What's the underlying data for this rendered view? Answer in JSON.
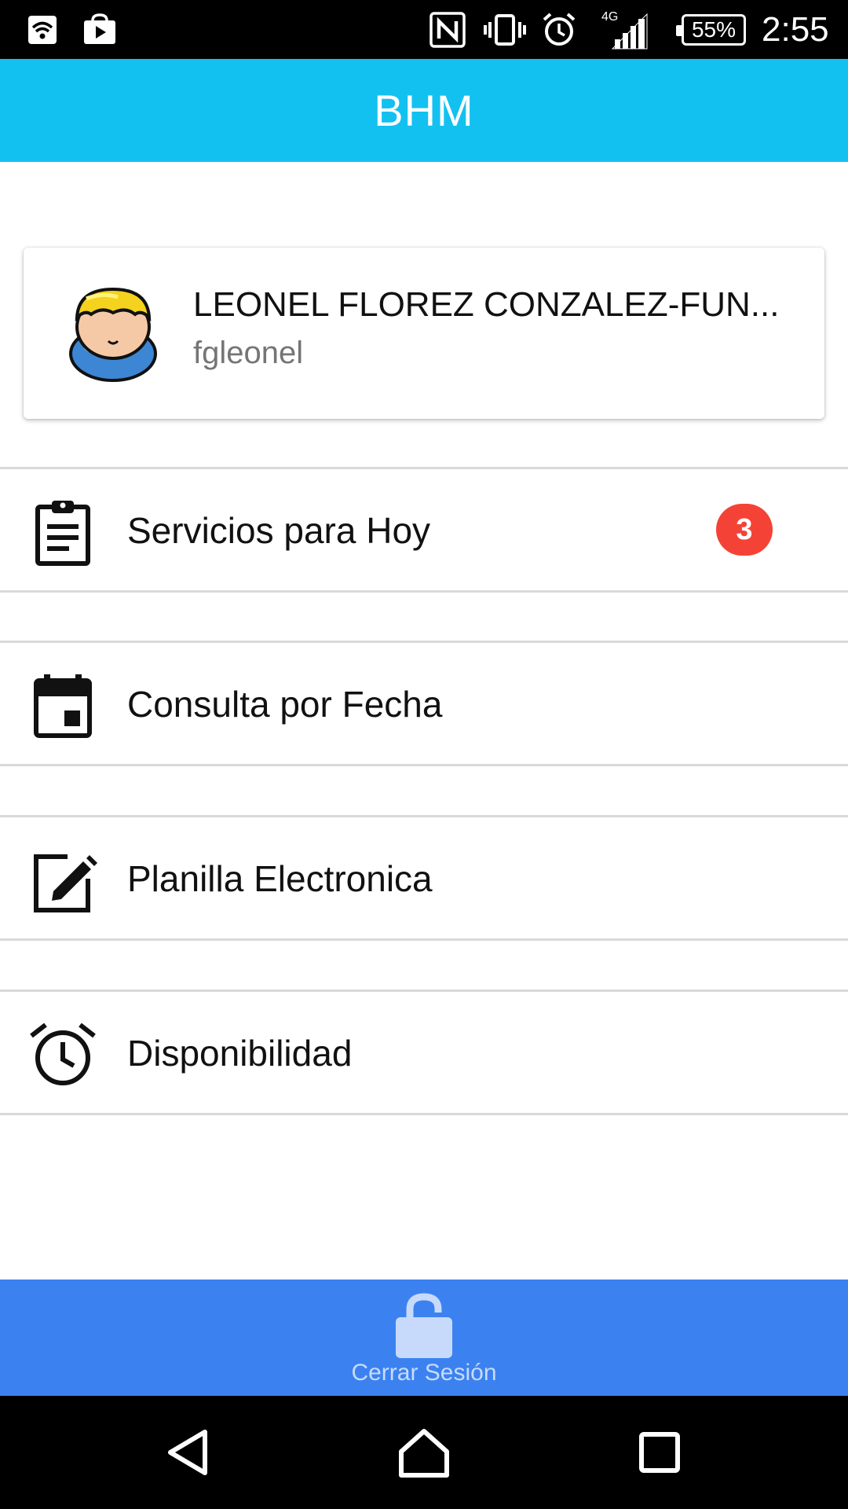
{
  "status_bar": {
    "battery": "55%",
    "network": "4G",
    "time": "2:55"
  },
  "app_bar": {
    "title": "BHM"
  },
  "profile": {
    "name": "LEONEL FLOREZ CONZALEZ-FUN...",
    "username": "fgleonel"
  },
  "menu": {
    "items": [
      {
        "label": "Servicios para Hoy",
        "icon": "clipboard-icon",
        "badge": "3"
      },
      {
        "label": "Consulta por Fecha",
        "icon": "calendar-icon"
      },
      {
        "label": "Planilla Electronica",
        "icon": "edit-icon"
      },
      {
        "label": "Disponibilidad",
        "icon": "alarm-clock-icon"
      }
    ]
  },
  "logout": {
    "label": "Cerrar Sesión",
    "icon": "unlock-icon"
  },
  "colors": {
    "app_bar": "#13c1f0",
    "logout_bar": "#3b82f0",
    "badge": "#f44336"
  }
}
